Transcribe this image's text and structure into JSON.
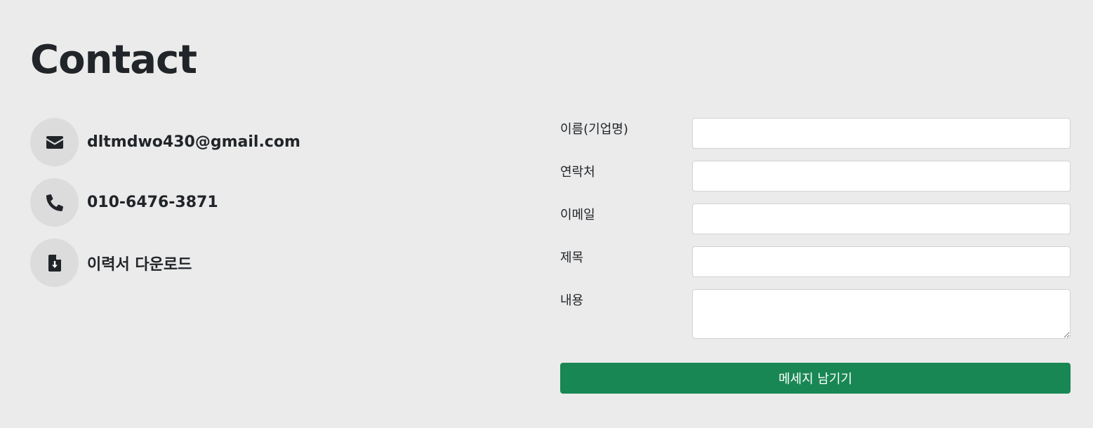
{
  "page": {
    "title": "Contact"
  },
  "contacts": [
    {
      "icon": "envelope-icon",
      "text": "dltmdwo430@gmail.com"
    },
    {
      "icon": "phone-icon",
      "text": "010-6476-3871"
    },
    {
      "icon": "file-download-icon",
      "text": "이력서 다운로드"
    }
  ],
  "form": {
    "fields": [
      {
        "label": "이름(기업명)",
        "value": "",
        "placeholder": ""
      },
      {
        "label": "연락처",
        "value": "",
        "placeholder": ""
      },
      {
        "label": "이메일",
        "value": "",
        "placeholder": ""
      },
      {
        "label": "제목",
        "value": "",
        "placeholder": ""
      },
      {
        "label": "내용",
        "value": "",
        "placeholder": ""
      }
    ],
    "submit_label": "메세지 남기기"
  },
  "colors": {
    "background": "#ebebeb",
    "icon_circle": "#dcdcdc",
    "text": "#212529",
    "submit_button": "#198754",
    "submit_text": "#ffffff"
  }
}
